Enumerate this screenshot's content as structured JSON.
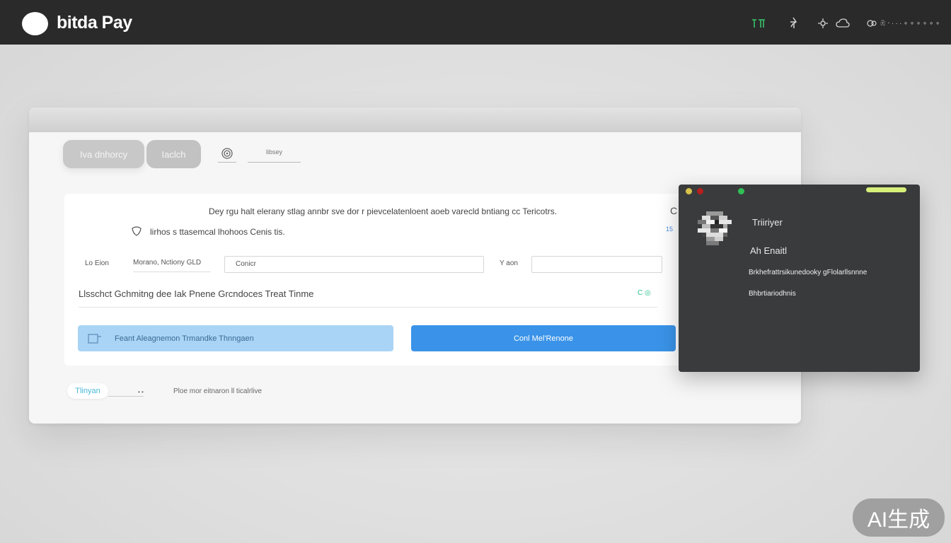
{
  "header": {
    "brand": "bitda Pay",
    "account_label": "ඹ ‧ ∙ ∙ ∙ ∘ ∘ ∘ ∘ ∘ ∘",
    "icons": [
      "green-grid-icon",
      "pin-icon",
      "settings-icon",
      "cloud-icon",
      "user-icon"
    ]
  },
  "tabs": [
    {
      "label": "Iva dnhorcy"
    },
    {
      "label": "Iaclch"
    }
  ],
  "tab_link": "libsey",
  "card": {
    "description": "Dey rgu halt elerany stlag annbr sve dor r pievcelatenloent aoeb varecld bntiang cc Tericotrs.",
    "subtext": "lirhos s ttasemcal lhohoos Cenis tis.",
    "side_link": "15",
    "fields": [
      {
        "label": "Lo Eion",
        "value": "Morano, Nctiony GLD"
      },
      {
        "label": "",
        "placeholder": "Conicr"
      },
      {
        "label": "Y aon",
        "value": ""
      }
    ],
    "list_line": "Llsschct Gchmitng  dee Iak  Pnene Grcndoces  Treat Tinme",
    "status": "C ◎",
    "btn_light": "Feant Aleagnemon  Trmandke Thnngaen",
    "btn_primary": "Conl Mel'Renone"
  },
  "footer": {
    "pill": "Tlinyan",
    "arrows": "• •",
    "note": "Ploe mor eitnaron ll ticalrlive"
  },
  "popup": {
    "name": "Triiriyer",
    "email": "Ah Enaitl",
    "line1": "Brkhefrattrsikunedooky gFlolarllsnnne",
    "line2": "Bhbrtiariodhnis"
  },
  "watermark": "AI生成",
  "colors": {
    "topbar": "#2a2a2a",
    "primary": "#3a93e8",
    "light_button": "#a9d4f5",
    "popup": "#323335",
    "popup_accent": "#d7f07a"
  }
}
